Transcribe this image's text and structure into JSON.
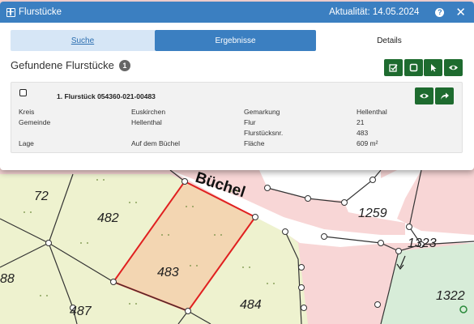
{
  "window": {
    "title": "Flurstücke",
    "status": "Aktualität: 14.05.2024",
    "help_label": "?",
    "close_label": "✕"
  },
  "tabs": [
    {
      "label": "Suche"
    },
    {
      "label": "Ergebnisse"
    },
    {
      "label": "Details"
    }
  ],
  "results": {
    "heading": "Gefundene Flurstücke",
    "count": "1",
    "actions": [
      "edit-icon",
      "select-icon",
      "cursor-icon",
      "eye-icon"
    ]
  },
  "parcel": {
    "title": "1. Flurstück 054360-021-00483",
    "actions": [
      "eye-icon",
      "share-arrow-icon"
    ],
    "fields": [
      {
        "label": "Kreis",
        "value": "Euskirchen"
      },
      {
        "label": "Gemeinde",
        "value": "Hellenthal"
      },
      {
        "label": "Lage",
        "value": "Auf dem Büchel"
      },
      {
        "label": "Gemarkung",
        "value": "Hellenthal"
      },
      {
        "label": "Flur",
        "value": "21"
      },
      {
        "label": "Flurstücksnr.",
        "value": "483"
      },
      {
        "label": "Fläche",
        "value": "609 m²"
      }
    ]
  },
  "map": {
    "street_name": "Büchel",
    "parcel_numbers": [
      "72",
      "482",
      "483",
      "484",
      "487",
      "88",
      "1259",
      "1323",
      "1322"
    ],
    "colors": {
      "parcel_pink": "#f8d6d6",
      "parcel_green": "#eef2cf",
      "selected_parcel": "#f3d6b2",
      "selected_outline": "#e02020",
      "street": "#ffffff"
    }
  }
}
